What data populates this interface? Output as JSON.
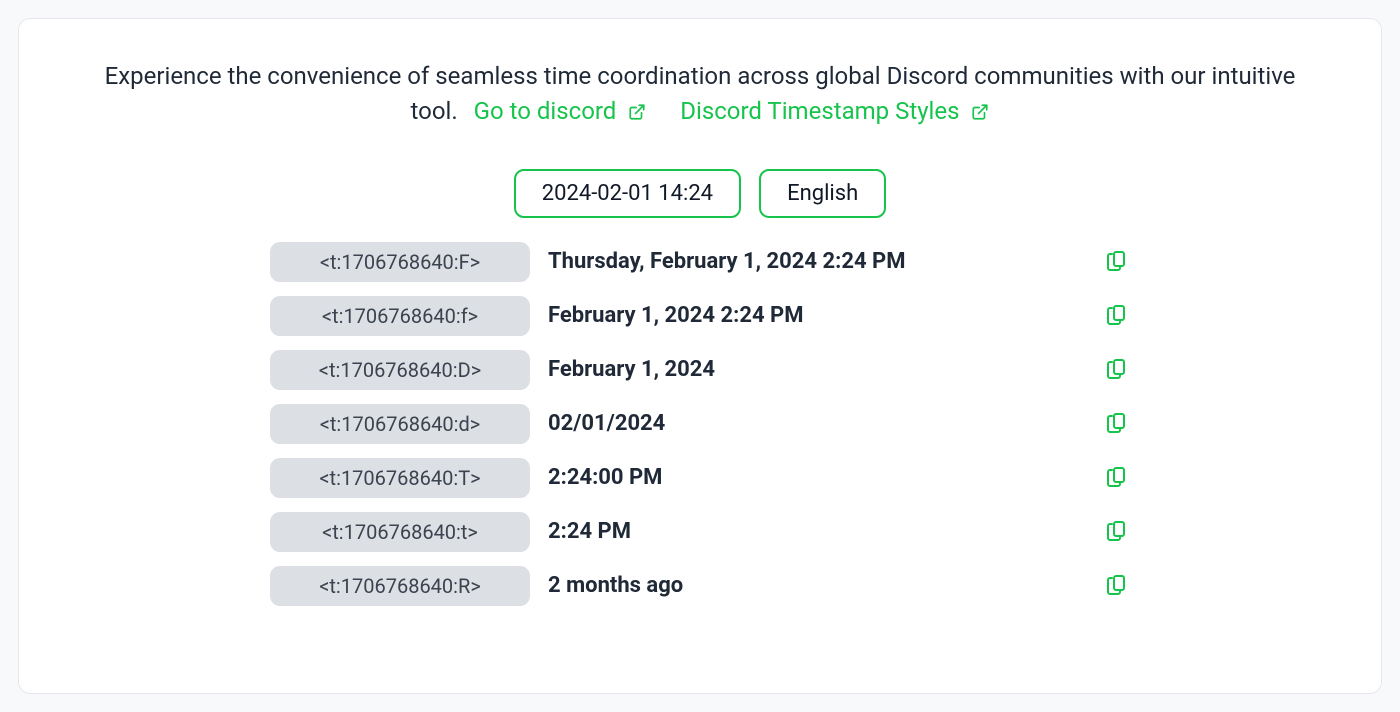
{
  "intro": {
    "text": "Experience the convenience of seamless time coordination across global Discord communities with our intuitive tool.",
    "link1": "Go to discord",
    "link2": "Discord Timestamp Styles"
  },
  "controls": {
    "datetime": "2024-02-01 14:24",
    "language": "English"
  },
  "rows": [
    {
      "code": "<t:1706768640:F>",
      "preview": "Thursday, February 1, 2024 2:24 PM"
    },
    {
      "code": "<t:1706768640:f>",
      "preview": "February 1, 2024 2:24 PM"
    },
    {
      "code": "<t:1706768640:D>",
      "preview": "February 1, 2024"
    },
    {
      "code": "<t:1706768640:d>",
      "preview": "02/01/2024"
    },
    {
      "code": "<t:1706768640:T>",
      "preview": "2:24:00 PM"
    },
    {
      "code": "<t:1706768640:t>",
      "preview": "2:24 PM"
    },
    {
      "code": "<t:1706768640:R>",
      "preview": "2 months ago"
    }
  ]
}
